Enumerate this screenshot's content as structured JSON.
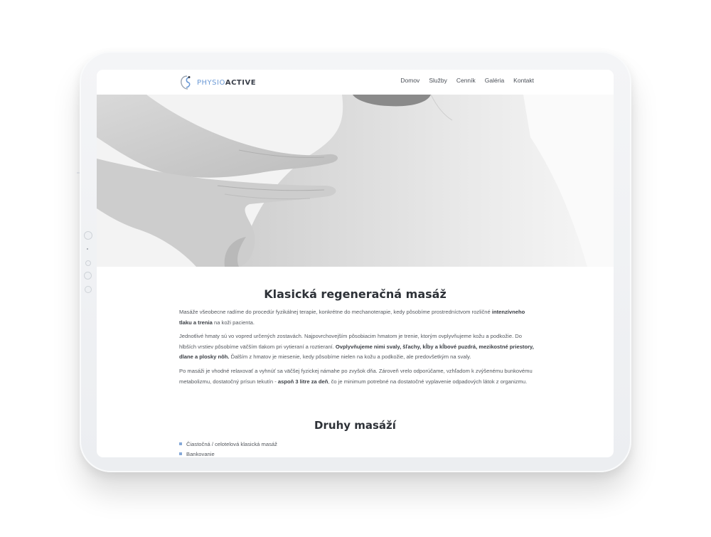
{
  "logo": {
    "part1": "PHYSIO",
    "part2": "ACTIVE"
  },
  "nav": {
    "items": [
      "Domov",
      "Služby",
      "Cenník",
      "Galéria",
      "Kontakt"
    ]
  },
  "colors": {
    "accent": "#6c9ad6",
    "bullet": "#86a9d8",
    "heading": "#2e3238",
    "text": "#55595f"
  },
  "main": {
    "title": "Klasická regeneračná masáž",
    "p1": {
      "a": "Masáže všeobecne radíme do procedúr fyzikálnej terapie, konkrétne do mechanoterapie, kedy pôsobíme prostredníctvom rozličné ",
      "b": "intenzívneho tlaku a trenia",
      "c": " na koži pacienta."
    },
    "p2": {
      "a": "Jednotlivé hmaty sú vo vopred určených zostavách. Najpovrchovejším pôsobiacim hmatom je trenie, ktorým ovplyvňujeme kožu a podkožie. Do hlbších vrstiev pôsobíme väčším tlakom pri vytieraní a roztieraní. ",
      "b": "Ovplyvňujeme nimi svaly, šľachy, kĺby a kĺbové puzdrá, mezikostné priestory, dlane a plosky nôh.",
      "c": " Ďalším z hmatov je miesenie, kedy pôsobíme nielen na kožu a podkožie, ale predovšetkým na svaly."
    },
    "p3": {
      "a": "Po masáži je vhodné relaxovať a vyhnúť sa väčšej fyzickej námahe po zvyšok dňa. Zároveň vrelo odporúčame, vzhľadom k zvýšenému bunkovému metabolizmu, dostatočný prísun tekutín - ",
      "b": "aspoň 3 litre za deň",
      "c": ", čo je minimum potrebné na dostatočné vyplavenie odpadových látok z organizmu."
    },
    "subtitle": "Druhy masáží",
    "list": [
      "Čiastočná / celotelová klasická masáž",
      "Bankovanie"
    ]
  }
}
